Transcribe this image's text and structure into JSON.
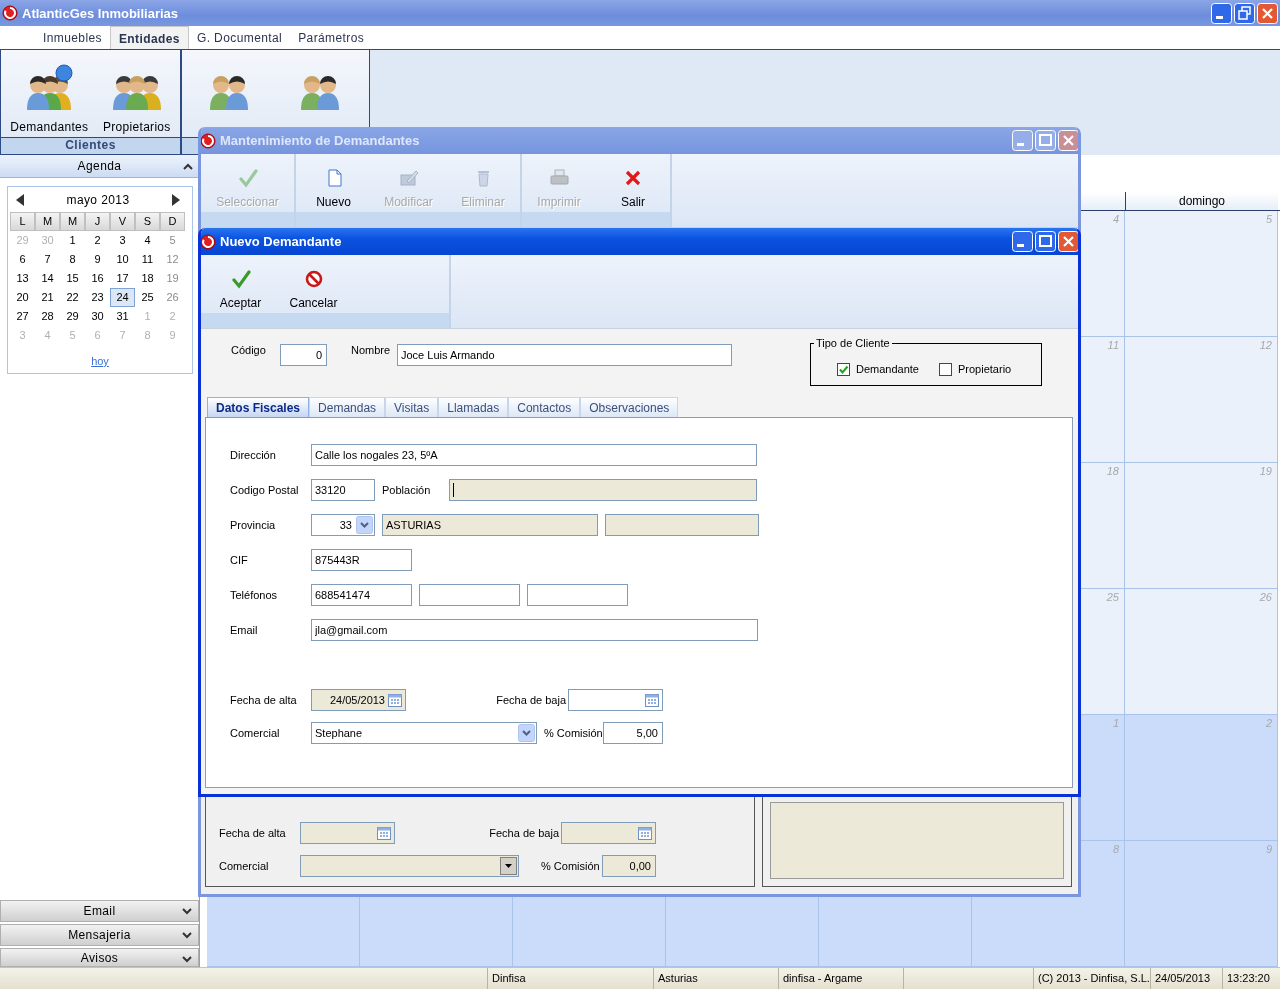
{
  "app": {
    "title": "AtlanticGes Inmobiliarias"
  },
  "menu_tabs": [
    {
      "label": "Inmuebles",
      "selected": false
    },
    {
      "label": "Entidades",
      "selected": true
    },
    {
      "label": "G. Documental",
      "selected": false
    },
    {
      "label": "Parámetros",
      "selected": false
    }
  ],
  "ribbon": {
    "groups": [
      {
        "label": "Clientes",
        "buttons": [
          {
            "label": "Demandantes",
            "kind": "people_question"
          },
          {
            "label": "Propietarios",
            "kind": "people_trio"
          }
        ]
      },
      {
        "buttons": [
          {
            "kind": "people_pair"
          },
          {
            "kind": "people_pair"
          }
        ]
      }
    ]
  },
  "sidebar": {
    "agenda": {
      "title": "Agenda",
      "expanded": true
    },
    "mini_calendar": {
      "month": "mayo 2013",
      "weekdays": [
        "L",
        "M",
        "M",
        "J",
        "V",
        "S",
        "D"
      ],
      "weeks": [
        [
          {
            "day": "29",
            "other_month": true,
            "selected": false
          },
          {
            "day": "30",
            "other_month": true,
            "selected": false
          },
          {
            "day": "1",
            "other_month": false,
            "selected": false
          },
          {
            "day": "2",
            "other_month": false,
            "selected": false
          },
          {
            "day": "3",
            "other_month": false,
            "selected": false
          },
          {
            "day": "4",
            "other_month": false,
            "selected": false
          },
          {
            "day": "5",
            "other_month": false,
            "selected": false
          }
        ],
        [
          {
            "day": "6",
            "other_month": false,
            "selected": false
          },
          {
            "day": "7",
            "other_month": false,
            "selected": false
          },
          {
            "day": "8",
            "other_month": false,
            "selected": false
          },
          {
            "day": "9",
            "other_month": false,
            "selected": false
          },
          {
            "day": "10",
            "other_month": false,
            "selected": false
          },
          {
            "day": "11",
            "other_month": false,
            "selected": false
          },
          {
            "day": "12",
            "other_month": false,
            "selected": false
          }
        ],
        [
          {
            "day": "13",
            "other_month": false,
            "selected": false
          },
          {
            "day": "14",
            "other_month": false,
            "selected": false
          },
          {
            "day": "15",
            "other_month": false,
            "selected": false
          },
          {
            "day": "16",
            "other_month": false,
            "selected": false
          },
          {
            "day": "17",
            "other_month": false,
            "selected": false
          },
          {
            "day": "18",
            "other_month": false,
            "selected": false
          },
          {
            "day": "19",
            "other_month": false,
            "selected": false
          }
        ],
        [
          {
            "day": "20",
            "other_month": false,
            "selected": false
          },
          {
            "day": "21",
            "other_month": false,
            "selected": false
          },
          {
            "day": "22",
            "other_month": false,
            "selected": false
          },
          {
            "day": "23",
            "other_month": false,
            "selected": false
          },
          {
            "day": "24",
            "other_month": false,
            "selected": true
          },
          {
            "day": "25",
            "other_month": false,
            "selected": false
          },
          {
            "day": "26",
            "other_month": false,
            "selected": false
          }
        ],
        [
          {
            "day": "27",
            "other_month": false,
            "selected": false
          },
          {
            "day": "28",
            "other_month": false,
            "selected": false
          },
          {
            "day": "29",
            "other_month": false,
            "selected": false
          },
          {
            "day": "30",
            "other_month": false,
            "selected": false
          },
          {
            "day": "31",
            "other_month": false,
            "selected": false
          },
          {
            "day": "1",
            "other_month": true,
            "selected": false
          },
          {
            "day": "2",
            "other_month": true,
            "selected": false
          }
        ],
        [
          {
            "day": "3",
            "other_month": true,
            "selected": false
          },
          {
            "day": "4",
            "other_month": true,
            "selected": false
          },
          {
            "day": "5",
            "other_month": true,
            "selected": false
          },
          {
            "day": "6",
            "other_month": true,
            "selected": false
          },
          {
            "day": "7",
            "other_month": true,
            "selected": false
          },
          {
            "day": "8",
            "other_month": true,
            "selected": false
          },
          {
            "day": "9",
            "other_month": true,
            "selected": false
          }
        ]
      ],
      "today_link": "hoy"
    },
    "sections": [
      {
        "label": "Email",
        "expanded": false
      },
      {
        "label": "Mensajeria",
        "expanded": false
      },
      {
        "label": "Avisos",
        "expanded": false
      }
    ]
  },
  "month_view": {
    "sunday_header": "domingo",
    "weeks": [
      {
        "saturday": "4",
        "sunday": "5",
        "next_month": false
      },
      {
        "saturday": "11",
        "sunday": "12",
        "next_month": false
      },
      {
        "saturday": "18",
        "sunday": "19",
        "next_month": false
      },
      {
        "saturday": "25",
        "sunday": "26",
        "next_month": false
      },
      {
        "saturday": "1",
        "sunday": "2",
        "next_month": true
      },
      {
        "saturday": "8",
        "sunday": "9",
        "next_month": true
      }
    ]
  },
  "windows": [
    {
      "title": "Mantenimiento de Demandantes",
      "active": false,
      "toolbar": [
        [
          {
            "label": "Seleccionar",
            "kind": "check",
            "disabled": true
          }
        ],
        [
          {
            "label": "Nuevo",
            "kind": "document",
            "disabled": false
          },
          {
            "label": "Modificar",
            "kind": "edit",
            "disabled": true
          },
          {
            "label": "Eliminar",
            "kind": "trash",
            "disabled": true
          }
        ],
        [
          {
            "label": "Imprimir",
            "kind": "printer",
            "disabled": true
          },
          {
            "label": "Salir",
            "kind": "x",
            "disabled": false
          }
        ]
      ],
      "bottom_form": {
        "rows": [
          {
            "items": [
              {
                "kind": "label",
                "text": "Fecha de alta"
              },
              {
                "kind": "date",
                "disabled": true
              },
              {
                "kind": "label",
                "text": "Fecha de baja"
              },
              {
                "kind": "date",
                "disabled": true
              }
            ]
          },
          {
            "items": [
              {
                "kind": "label",
                "text": "Comercial"
              },
              {
                "kind": "combo",
                "disabled": true
              },
              {
                "kind": "label",
                "text": "% Comisión"
              },
              {
                "kind": "number",
                "value": "0,00",
                "disabled": true
              }
            ]
          }
        ],
        "notes": {
          "disabled": true
        }
      }
    },
    {
      "title": "Nuevo Demandante",
      "active": true,
      "toolbar": [
        [
          {
            "label": "Aceptar",
            "kind": "check",
            "disabled": false
          },
          {
            "label": "Cancelar",
            "kind": "no_entry",
            "disabled": false
          }
        ]
      ],
      "header": [
        {
          "kind": "label",
          "text": "Código"
        },
        {
          "kind": "number",
          "value": "0",
          "disabled": false
        },
        {
          "kind": "label",
          "text": "Nombre"
        },
        {
          "kind": "text",
          "value": "Joce Luis Armando",
          "disabled": false
        }
      ],
      "tipo_cliente": {
        "legend": "Tipo de Cliente",
        "options": [
          {
            "label": "Demandante",
            "checked": true
          },
          {
            "label": "Propietario",
            "checked": false
          }
        ]
      },
      "tabs": [
        {
          "label": "Datos Fiscales",
          "selected": true
        },
        {
          "label": "Demandas",
          "selected": false
        },
        {
          "label": "Visitas",
          "selected": false
        },
        {
          "label": "Llamadas",
          "selected": false
        },
        {
          "label": "Contactos",
          "selected": false
        },
        {
          "label": "Observaciones",
          "selected": false
        }
      ],
      "fiscal_form": {
        "rows": [
          {
            "items": [
              {
                "kind": "label",
                "text": "Dirección"
              },
              {
                "kind": "text",
                "value": "Calle los nogales 23, 5ºA",
                "disabled": false
              }
            ]
          },
          {
            "items": [
              {
                "kind": "label",
                "text": "Codigo Postal"
              },
              {
                "kind": "text",
                "value": "33120",
                "disabled": false
              },
              {
                "kind": "label",
                "text": "Población"
              },
              {
                "kind": "text",
                "disabled": true,
                "focused": true
              }
            ]
          },
          {
            "items": [
              {
                "kind": "label",
                "text": "Provincia"
              },
              {
                "kind": "code_combo",
                "value": "33",
                "disabled": false
              },
              {
                "kind": "text",
                "value": "ASTURIAS",
                "disabled": true
              },
              {
                "kind": "text",
                "disabled": true
              }
            ]
          },
          {
            "items": [
              {
                "kind": "label",
                "text": "CIF"
              },
              {
                "kind": "text",
                "value": "875443R",
                "disabled": false
              }
            ]
          },
          {
            "items": [
              {
                "kind": "label",
                "text": "Teléfonos"
              },
              {
                "kind": "text",
                "value": "688541474",
                "disabled": false
              },
              {
                "kind": "text",
                "disabled": false
              },
              {
                "kind": "text",
                "disabled": false
              }
            ]
          },
          {
            "items": [
              {
                "kind": "label",
                "text": "Email"
              },
              {
                "kind": "text",
                "value": "jla@gmail.com",
                "disabled": false
              }
            ]
          },
          {
            "items": [
              {
                "kind": "label",
                "text": "Fecha de alta"
              },
              {
                "kind": "date",
                "value": "24/05/2013",
                "disabled": true
              },
              {
                "kind": "label",
                "text": "Fecha de baja"
              },
              {
                "kind": "date",
                "disabled": false
              }
            ]
          },
          {
            "items": [
              {
                "kind": "label",
                "text": "Comercial"
              },
              {
                "kind": "combo",
                "value": "Stephane",
                "disabled": false
              },
              {
                "kind": "label",
                "text": "% Comisión"
              },
              {
                "kind": "number",
                "value": "5,00",
                "disabled": false
              }
            ]
          }
        ]
      }
    }
  ],
  "status_bar": [
    "Dinfisa",
    "Asturias",
    "dinfisa - Argame",
    "(C) 2013 - Dinfisa, S.L.",
    "24/05/2013",
    "13:23:20"
  ]
}
